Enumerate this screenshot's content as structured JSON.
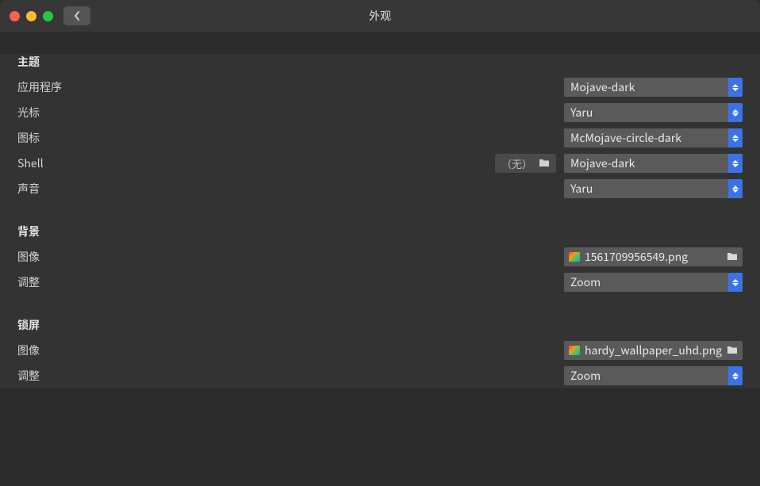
{
  "window": {
    "title": "外观"
  },
  "sections": {
    "theme": {
      "heading": "主题",
      "app": {
        "label": "应用程序",
        "value": "Mojave-dark"
      },
      "cursor": {
        "label": "光标",
        "value": "Yaru"
      },
      "icons": {
        "label": "图标",
        "value": "McMojave-circle-dark"
      },
      "shell": {
        "label": "Shell",
        "badge": "（无）",
        "value": "Mojave-dark"
      },
      "sound": {
        "label": "声音",
        "value": "Yaru"
      }
    },
    "background": {
      "heading": "背景",
      "image": {
        "label": "图像",
        "value": "1561709956549.png"
      },
      "adjust": {
        "label": "调整",
        "value": "Zoom"
      }
    },
    "lockscreen": {
      "heading": "锁屏",
      "image": {
        "label": "图像",
        "value": "hardy_wallpaper_uhd.png"
      },
      "adjust": {
        "label": "调整",
        "value": "Zoom"
      }
    }
  }
}
